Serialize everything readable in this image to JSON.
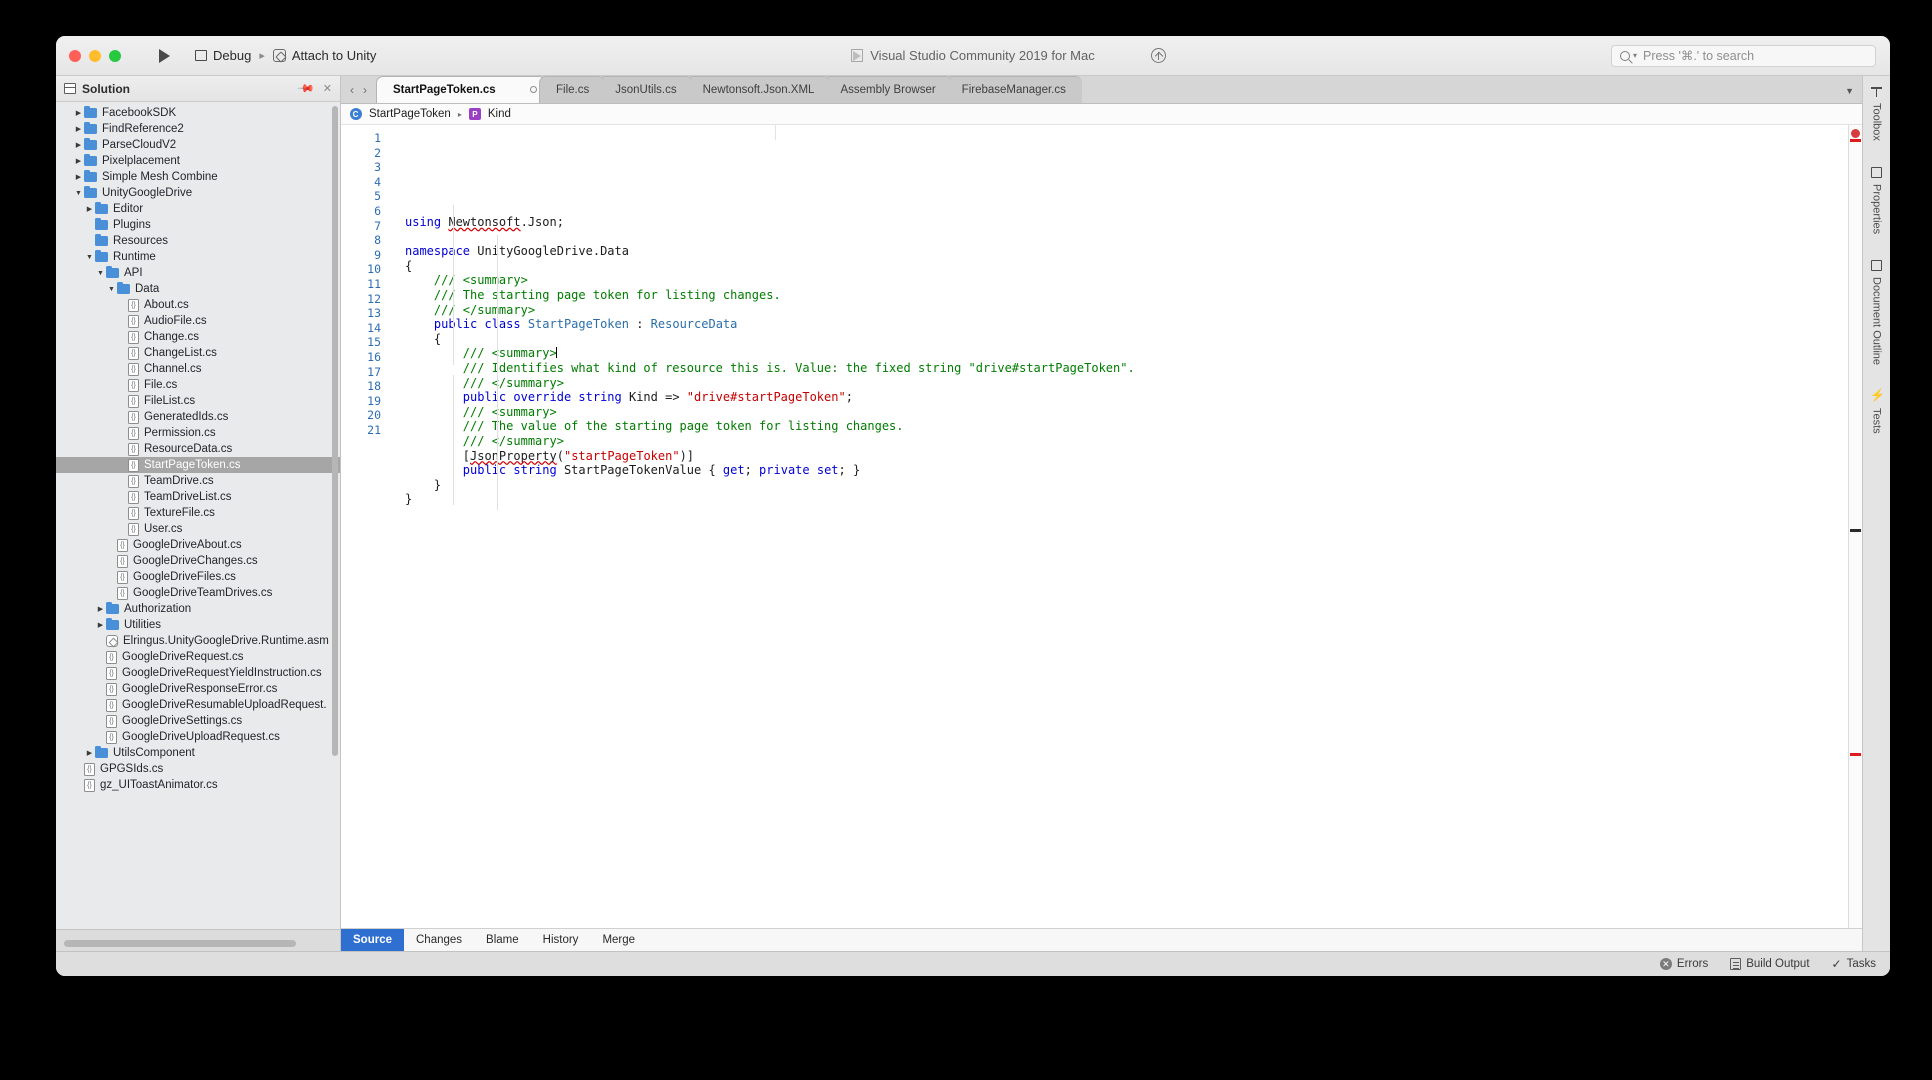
{
  "window": {
    "traffic_lights": [
      "close",
      "minimize",
      "maximize"
    ],
    "app_title": "Visual Studio Community 2019 for Mac",
    "run_config": {
      "configuration": "Debug",
      "target": "Attach to Unity"
    },
    "search": {
      "placeholder": "Press '⌘.' to search"
    }
  },
  "sidebar": {
    "title": "Solution",
    "tree": [
      {
        "label": "FacebookSDK",
        "kind": "folder",
        "depth": 1,
        "arrow": "collapsed"
      },
      {
        "label": "FindReference2",
        "kind": "folder",
        "depth": 1,
        "arrow": "collapsed"
      },
      {
        "label": "ParseCloudV2",
        "kind": "folder",
        "depth": 1,
        "arrow": "collapsed"
      },
      {
        "label": "Pixelplacement",
        "kind": "folder",
        "depth": 1,
        "arrow": "collapsed"
      },
      {
        "label": "Simple Mesh Combine",
        "kind": "folder",
        "depth": 1,
        "arrow": "collapsed"
      },
      {
        "label": "UnityGoogleDrive",
        "kind": "folder",
        "depth": 1,
        "arrow": "expanded"
      },
      {
        "label": "Editor",
        "kind": "folder",
        "depth": 2,
        "arrow": "collapsed"
      },
      {
        "label": "Plugins",
        "kind": "folder",
        "depth": 2,
        "arrow": "none"
      },
      {
        "label": "Resources",
        "kind": "folder",
        "depth": 2,
        "arrow": "none"
      },
      {
        "label": "Runtime",
        "kind": "folder",
        "depth": 2,
        "arrow": "expanded"
      },
      {
        "label": "API",
        "kind": "folder",
        "depth": 3,
        "arrow": "expanded"
      },
      {
        "label": "Data",
        "kind": "folder",
        "depth": 4,
        "arrow": "expanded"
      },
      {
        "label": "About.cs",
        "kind": "cs",
        "depth": 5,
        "arrow": "none"
      },
      {
        "label": "AudioFile.cs",
        "kind": "cs",
        "depth": 5,
        "arrow": "none"
      },
      {
        "label": "Change.cs",
        "kind": "cs",
        "depth": 5,
        "arrow": "none"
      },
      {
        "label": "ChangeList.cs",
        "kind": "cs",
        "depth": 5,
        "arrow": "none"
      },
      {
        "label": "Channel.cs",
        "kind": "cs",
        "depth": 5,
        "arrow": "none"
      },
      {
        "label": "File.cs",
        "kind": "cs",
        "depth": 5,
        "arrow": "none"
      },
      {
        "label": "FileList.cs",
        "kind": "cs",
        "depth": 5,
        "arrow": "none"
      },
      {
        "label": "GeneratedIds.cs",
        "kind": "cs",
        "depth": 5,
        "arrow": "none"
      },
      {
        "label": "Permission.cs",
        "kind": "cs",
        "depth": 5,
        "arrow": "none"
      },
      {
        "label": "ResourceData.cs",
        "kind": "cs",
        "depth": 5,
        "arrow": "none"
      },
      {
        "label": "StartPageToken.cs",
        "kind": "cs",
        "depth": 5,
        "arrow": "none",
        "selected": true
      },
      {
        "label": "TeamDrive.cs",
        "kind": "cs",
        "depth": 5,
        "arrow": "none"
      },
      {
        "label": "TeamDriveList.cs",
        "kind": "cs",
        "depth": 5,
        "arrow": "none"
      },
      {
        "label": "TextureFile.cs",
        "kind": "cs",
        "depth": 5,
        "arrow": "none"
      },
      {
        "label": "User.cs",
        "kind": "cs",
        "depth": 5,
        "arrow": "none"
      },
      {
        "label": "GoogleDriveAbout.cs",
        "kind": "cs",
        "depth": 4,
        "arrow": "none"
      },
      {
        "label": "GoogleDriveChanges.cs",
        "kind": "cs",
        "depth": 4,
        "arrow": "none"
      },
      {
        "label": "GoogleDriveFiles.cs",
        "kind": "cs",
        "depth": 4,
        "arrow": "none"
      },
      {
        "label": "GoogleDriveTeamDrives.cs",
        "kind": "cs",
        "depth": 4,
        "arrow": "none"
      },
      {
        "label": "Authorization",
        "kind": "folder",
        "depth": 3,
        "arrow": "collapsed"
      },
      {
        "label": "Utilities",
        "kind": "folder",
        "depth": 3,
        "arrow": "collapsed"
      },
      {
        "label": "Elringus.UnityGoogleDrive.Runtime.asm",
        "kind": "asm",
        "depth": 3,
        "arrow": "none"
      },
      {
        "label": "GoogleDriveRequest.cs",
        "kind": "cs",
        "depth": 3,
        "arrow": "none"
      },
      {
        "label": "GoogleDriveRequestYieldInstruction.cs",
        "kind": "cs",
        "depth": 3,
        "arrow": "none"
      },
      {
        "label": "GoogleDriveResponseError.cs",
        "kind": "cs",
        "depth": 3,
        "arrow": "none"
      },
      {
        "label": "GoogleDriveResumableUploadRequest.",
        "kind": "cs",
        "depth": 3,
        "arrow": "none"
      },
      {
        "label": "GoogleDriveSettings.cs",
        "kind": "cs",
        "depth": 3,
        "arrow": "none"
      },
      {
        "label": "GoogleDriveUploadRequest.cs",
        "kind": "cs",
        "depth": 3,
        "arrow": "none"
      },
      {
        "label": "UtilsComponent",
        "kind": "folder",
        "depth": 2,
        "arrow": "collapsed"
      },
      {
        "label": "GPGSIds.cs",
        "kind": "cs",
        "depth": 1,
        "arrow": "none"
      },
      {
        "label": "gz_UIToastAnimator.cs",
        "kind": "cs",
        "depth": 1,
        "arrow": "none"
      }
    ]
  },
  "editor": {
    "tabs": [
      {
        "label": "StartPageToken.cs",
        "active": true,
        "modified": true
      },
      {
        "label": "File.cs",
        "active": false,
        "modified": false
      },
      {
        "label": "JsonUtils.cs",
        "active": false,
        "modified": false
      },
      {
        "label": "Newtonsoft.Json.XML",
        "active": false,
        "modified": false
      },
      {
        "label": "Assembly Browser",
        "active": false,
        "modified": false
      },
      {
        "label": "FirebaseManager.cs",
        "active": false,
        "modified": false
      }
    ],
    "breadcrumb": [
      {
        "label": "StartPageToken",
        "icon": "class-icon"
      },
      {
        "label": "Kind",
        "icon": "property-icon"
      }
    ],
    "line_numbers": [
      1,
      2,
      3,
      4,
      5,
      6,
      7,
      8,
      9,
      10,
      11,
      12,
      13,
      14,
      15,
      16,
      17,
      18,
      19,
      20,
      21
    ],
    "code_lines": [
      [
        {
          "t": "using ",
          "c": "kw"
        },
        {
          "t": "Newtonsoft",
          "c": "plain squiggle"
        },
        {
          "t": ".Json;",
          "c": "plain"
        }
      ],
      [],
      [
        {
          "t": "namespace ",
          "c": "kw"
        },
        {
          "t": "UnityGoogleDrive.Data",
          "c": "plain"
        }
      ],
      [
        {
          "t": "{",
          "c": "plain"
        }
      ],
      [
        {
          "t": "    /// <summary>",
          "c": "cmt"
        }
      ],
      [
        {
          "t": "    /// The starting page token for listing changes.",
          "c": "cmt"
        }
      ],
      [
        {
          "t": "    /// </summary>",
          "c": "cmt"
        }
      ],
      [
        {
          "t": "    ",
          "c": "plain"
        },
        {
          "t": "public class ",
          "c": "kw"
        },
        {
          "t": "StartPageToken",
          "c": "type"
        },
        {
          "t": " : ",
          "c": "plain"
        },
        {
          "t": "ResourceData",
          "c": "type"
        }
      ],
      [
        {
          "t": "    {",
          "c": "plain"
        }
      ],
      [
        {
          "t": "        /// <summary>",
          "c": "cmt"
        },
        {
          "t": "|CARET|",
          "c": "caret"
        }
      ],
      [
        {
          "t": "        /// Identifies what kind of resource this is. Value: the fixed string \"drive#startPageToken\".",
          "c": "cmt"
        }
      ],
      [
        {
          "t": "        /// </summary>",
          "c": "cmt"
        }
      ],
      [
        {
          "t": "        ",
          "c": "plain"
        },
        {
          "t": "public override string ",
          "c": "kw"
        },
        {
          "t": "Kind => ",
          "c": "plain"
        },
        {
          "t": "\"drive#startPageToken\"",
          "c": "str"
        },
        {
          "t": ";",
          "c": "plain"
        }
      ],
      [
        {
          "t": "        /// <summary>",
          "c": "cmt"
        }
      ],
      [
        {
          "t": "        /// The value of the starting page token for listing changes.",
          "c": "cmt"
        }
      ],
      [
        {
          "t": "        /// </summary>",
          "c": "cmt"
        }
      ],
      [
        {
          "t": "        [",
          "c": "plain"
        },
        {
          "t": "JsonProperty",
          "c": "plain squiggle"
        },
        {
          "t": "(",
          "c": "plain"
        },
        {
          "t": "\"startPageToken\"",
          "c": "str"
        },
        {
          "t": ")]",
          "c": "plain"
        }
      ],
      [
        {
          "t": "        ",
          "c": "plain"
        },
        {
          "t": "public string ",
          "c": "kw"
        },
        {
          "t": "StartPageTokenValue { ",
          "c": "plain"
        },
        {
          "t": "get",
          "c": "kw"
        },
        {
          "t": "; ",
          "c": "plain"
        },
        {
          "t": "private set",
          "c": "kw"
        },
        {
          "t": "; }",
          "c": "plain"
        }
      ],
      [
        {
          "t": "    }",
          "c": "plain"
        }
      ],
      [
        {
          "t": "}",
          "c": "plain"
        }
      ],
      []
    ]
  },
  "source_tabs": [
    {
      "label": "Source",
      "active": true
    },
    {
      "label": "Changes",
      "active": false
    },
    {
      "label": "Blame",
      "active": false
    },
    {
      "label": "History",
      "active": false
    },
    {
      "label": "Merge",
      "active": false
    }
  ],
  "right_rail": [
    {
      "label": "Toolbox",
      "icon": "toolbox-icon"
    },
    {
      "label": "Properties",
      "icon": "properties-icon"
    },
    {
      "label": "Document Outline",
      "icon": "document-outline-icon"
    },
    {
      "label": "Tests",
      "icon": "tests-icon"
    }
  ],
  "statusbar": [
    {
      "label": "Errors",
      "icon": "error-icon"
    },
    {
      "label": "Build Output",
      "icon": "build-output-icon"
    },
    {
      "label": "Tasks",
      "icon": "check-icon"
    }
  ],
  "colors": {
    "accent": "#2f6fd0",
    "keyword": "#0000d6",
    "comment": "#007c00",
    "string": "#c40000",
    "type": "#2b6ea8",
    "folder": "#4a90d9",
    "error_marker": "#e01b1b"
  }
}
